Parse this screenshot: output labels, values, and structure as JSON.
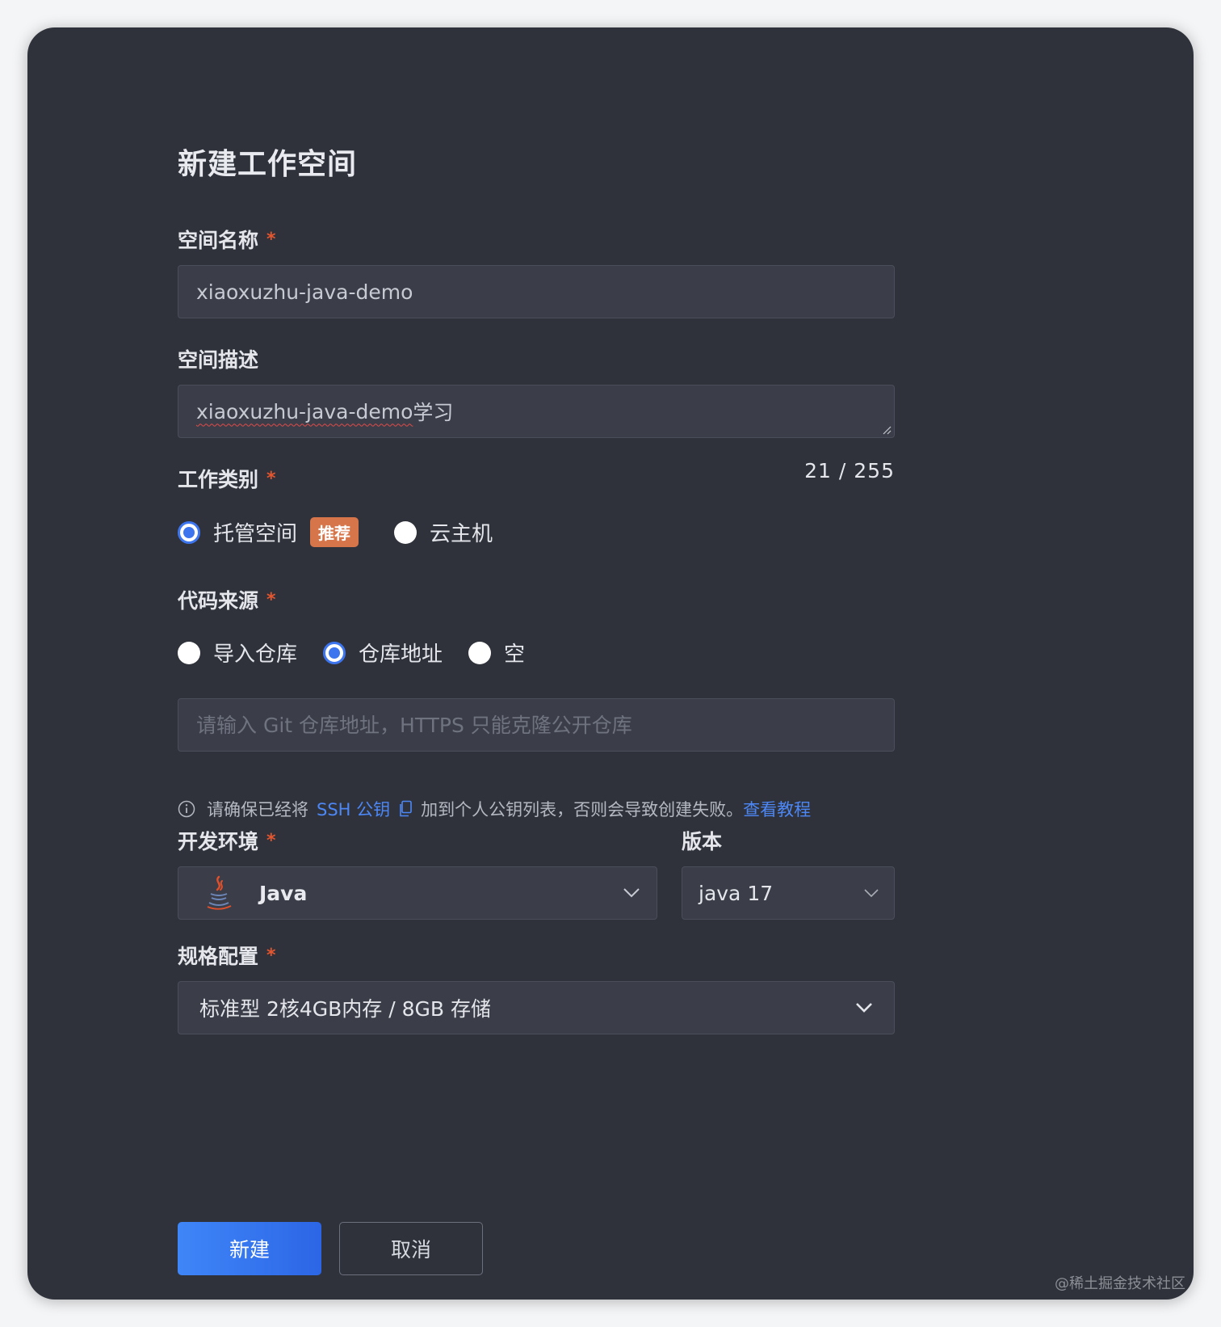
{
  "dialog": {
    "title": "新建工作空间"
  },
  "space_name": {
    "label": "空间名称",
    "required_mark": "*",
    "value": "xiaoxuzhu-java-demo"
  },
  "space_desc": {
    "label": "空间描述",
    "value_underlined": "xiaoxuzhu-java-demo",
    "value_rest": "学习",
    "counter": "21 / 255"
  },
  "work_type": {
    "label": "工作类别",
    "required_mark": "*",
    "options": [
      {
        "label": "托管空间",
        "badge": "推荐",
        "checked": true
      },
      {
        "label": "云主机",
        "checked": false
      }
    ]
  },
  "code_source": {
    "label": "代码来源",
    "required_mark": "*",
    "options": [
      {
        "label": "导入仓库",
        "checked": false
      },
      {
        "label": "仓库地址",
        "checked": true
      },
      {
        "label": "空",
        "checked": false
      }
    ],
    "repo_placeholder": "请输入 Git 仓库地址，HTTPS 只能克隆公开仓库",
    "hint_prefix": "请确保已经将",
    "hint_link": "SSH 公钥",
    "hint_middle": "加到个人公钥列表，否则会导致创建失败。",
    "hint_tutorial": "查看教程"
  },
  "dev_env": {
    "label": "开发环境",
    "required_mark": "*",
    "value": "Java",
    "icon": "java-icon"
  },
  "version": {
    "label": "版本",
    "value": "java 17"
  },
  "spec": {
    "label": "规格配置",
    "required_mark": "*",
    "value": "标准型 2核4GB内存 / 8GB 存储"
  },
  "actions": {
    "create_label": "新建",
    "cancel_label": "取消"
  },
  "watermark": "@稀土掘金技术社区",
  "colors": {
    "background": "#2f323b",
    "field": "#3b3e48",
    "accent": "#3d75ef",
    "required": "#e3562f",
    "badge": "#d7754a",
    "link": "#4c87f5"
  }
}
